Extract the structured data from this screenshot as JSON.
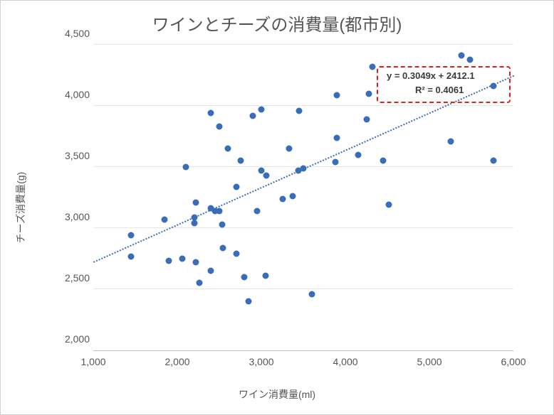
{
  "chart_data": {
    "type": "scatter",
    "title": "ワインとチーズの消費量(都市別)",
    "xlabel": "ワイン消費量(ml)",
    "ylabel": "チーズ消費量(g)",
    "xlim": [
      1000,
      6000
    ],
    "ylim": [
      2000,
      4500
    ],
    "x_ticks": [
      1000,
      2000,
      3000,
      4000,
      5000,
      6000
    ],
    "y_ticks": [
      2000,
      2500,
      3000,
      3500,
      4000,
      4500
    ],
    "x_tick_labels": [
      "1,000",
      "2,000",
      "3,000",
      "4,000",
      "5,000",
      "6,000"
    ],
    "y_tick_labels": [
      "2,000",
      "2,500",
      "3,000",
      "3,500",
      "4,000",
      "4,500"
    ],
    "trendline": {
      "equation_text": "y = 0.3049x + 2412.1",
      "r2_text": "R² = 0.4061",
      "slope": 0.3049,
      "intercept": 2412.1,
      "r2": 0.4061
    },
    "points": [
      {
        "x": 1450,
        "y": 2940
      },
      {
        "x": 1450,
        "y": 2770
      },
      {
        "x": 1850,
        "y": 3070
      },
      {
        "x": 1900,
        "y": 2730
      },
      {
        "x": 2060,
        "y": 2750
      },
      {
        "x": 2100,
        "y": 3500
      },
      {
        "x": 2200,
        "y": 3090
      },
      {
        "x": 2200,
        "y": 3040
      },
      {
        "x": 2220,
        "y": 3210
      },
      {
        "x": 2220,
        "y": 2720
      },
      {
        "x": 2260,
        "y": 2550
      },
      {
        "x": 2400,
        "y": 2650
      },
      {
        "x": 2400,
        "y": 3160
      },
      {
        "x": 2400,
        "y": 3940
      },
      {
        "x": 2450,
        "y": 3140
      },
      {
        "x": 2500,
        "y": 3140
      },
      {
        "x": 2500,
        "y": 3830
      },
      {
        "x": 2530,
        "y": 3030
      },
      {
        "x": 2540,
        "y": 2840
      },
      {
        "x": 2600,
        "y": 3650
      },
      {
        "x": 2700,
        "y": 3340
      },
      {
        "x": 2700,
        "y": 2790
      },
      {
        "x": 2750,
        "y": 3550
      },
      {
        "x": 2800,
        "y": 2600
      },
      {
        "x": 2850,
        "y": 2400
      },
      {
        "x": 2900,
        "y": 3920
      },
      {
        "x": 2950,
        "y": 3140
      },
      {
        "x": 3000,
        "y": 3470
      },
      {
        "x": 3000,
        "y": 3970
      },
      {
        "x": 3060,
        "y": 3430
      },
      {
        "x": 3050,
        "y": 2610
      },
      {
        "x": 3250,
        "y": 3240
      },
      {
        "x": 3330,
        "y": 3650
      },
      {
        "x": 3370,
        "y": 3260
      },
      {
        "x": 3440,
        "y": 3470
      },
      {
        "x": 3450,
        "y": 3960
      },
      {
        "x": 3500,
        "y": 3490
      },
      {
        "x": 3600,
        "y": 2460
      },
      {
        "x": 3880,
        "y": 3540
      },
      {
        "x": 3900,
        "y": 4090
      },
      {
        "x": 3900,
        "y": 3740
      },
      {
        "x": 4150,
        "y": 3600
      },
      {
        "x": 4250,
        "y": 3890
      },
      {
        "x": 4280,
        "y": 4100
      },
      {
        "x": 4320,
        "y": 4320
      },
      {
        "x": 4450,
        "y": 3550
      },
      {
        "x": 4520,
        "y": 3190
      },
      {
        "x": 5250,
        "y": 3710
      },
      {
        "x": 5380,
        "y": 4410
      },
      {
        "x": 5480,
        "y": 4380
      },
      {
        "x": 5760,
        "y": 4160
      },
      {
        "x": 5760,
        "y": 3550
      }
    ]
  }
}
